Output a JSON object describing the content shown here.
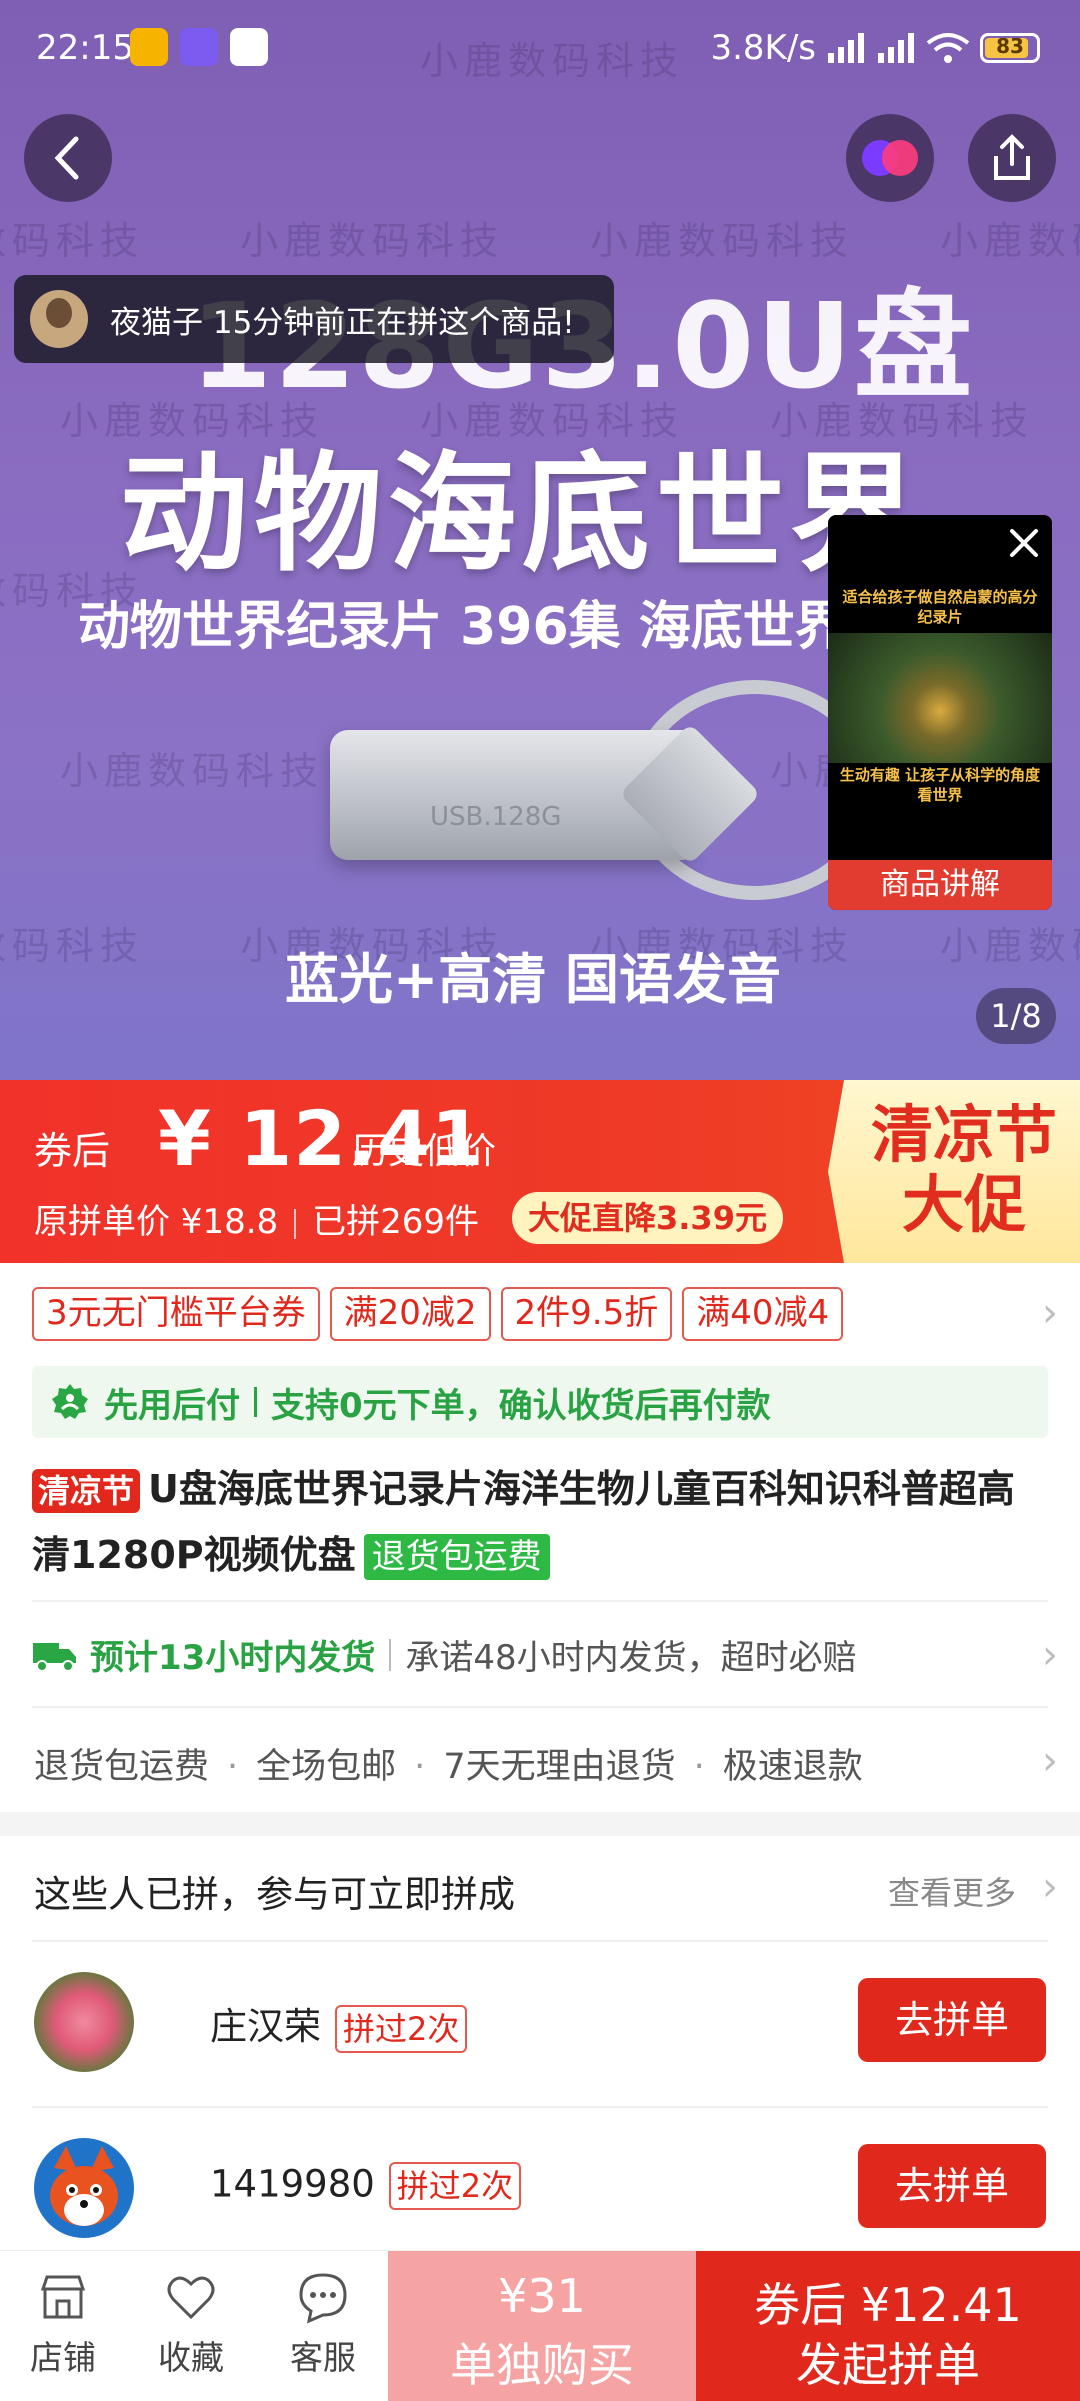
{
  "status_bar": {
    "time": "22:15",
    "speed": "3.8K/s",
    "battery": "83"
  },
  "hero": {
    "watermark": "小鹿数码科技",
    "title_line1": "128G3.0U盘",
    "title_line2": "动物海底世界",
    "subtitle": "动物世界纪录片 396集 海底世界纪录",
    "usb_label": "USB.128G",
    "bottom_text": "蓝光+高清 国语发音",
    "pager": "1/8",
    "notice": "夜猫子 15分钟前正在拼这个商品!",
    "video": {
      "top_text": "适合给孩子做自然启蒙的高分纪录片",
      "mid_text": "生动有趣 让孩子从科学的角度看世界",
      "label": "商品讲解"
    }
  },
  "price": {
    "coupon_label": "券后",
    "amount": "¥ 12.41",
    "history": "历史低价",
    "original": "原拼单价 ¥18.8",
    "sold": "已拼269件",
    "promo": "大促直降3.39元",
    "fest_line1": "清凉节",
    "fest_line2": "大促"
  },
  "coupons": [
    "3元无门槛平台券",
    "满20减2",
    "2件9.5折",
    "满40减4"
  ],
  "pay_later": {
    "title": "先用后付",
    "desc": "支持0元下单，确认收货后再付款"
  },
  "product": {
    "tag": "清凉节",
    "title": "U盘海底世界记录片海洋生物儿童百科知识科普超高清1280P视频优盘",
    "return_tag": "退货包运费"
  },
  "shipping": {
    "estimate": "预计13小时内发货",
    "promise": "承诺48小时内发货，超时必赔"
  },
  "services": [
    "退货包运费",
    "全场包邮",
    "7天无理由退货",
    "极速退款"
  ],
  "group": {
    "title": "这些人已拼，参与可立即拼成",
    "more": "查看更多",
    "rows": [
      {
        "name": "庄汉荣",
        "badge": "拼过2次",
        "button": "去拼单"
      },
      {
        "name": "1419980",
        "badge": "拼过2次",
        "button": "去拼单"
      }
    ]
  },
  "bottom": {
    "store": "店铺",
    "favorite": "收藏",
    "service": "客服",
    "single_price": "¥31",
    "single_label": "单独购买",
    "group_price": "券后 ¥12.41",
    "group_label": "发起拼单"
  }
}
